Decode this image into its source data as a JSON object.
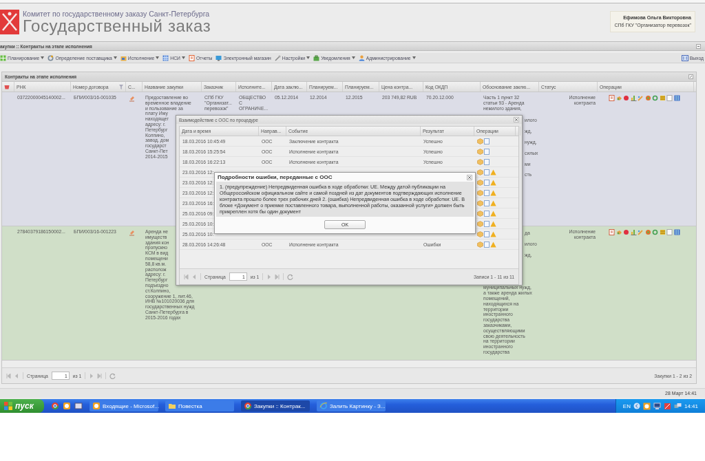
{
  "header": {
    "org": "Комитет по государственному заказу Санкт-Петербурга",
    "title": "Государственный заказ",
    "user_name": "Ефимова Ольга Викторовна",
    "user_org": "СПб ГКУ \"Организатор перевозок\""
  },
  "breadcrumb": "акупки :: Контракты на этапе исполнения",
  "menu": [
    {
      "label": "Планирование",
      "dropdown": true
    },
    {
      "label": "Определение поставщика",
      "dropdown": true
    },
    {
      "label": "Исполнение",
      "dropdown": true
    },
    {
      "label": "НСИ",
      "dropdown": true
    },
    {
      "label": "Отчеты",
      "dropdown": false
    },
    {
      "label": "Электронный магазин",
      "dropdown": false
    },
    {
      "label": "Настройки",
      "dropdown": true
    },
    {
      "label": "Уведомления",
      "dropdown": true
    },
    {
      "label": "Администрирование",
      "dropdown": true
    }
  ],
  "exit": "Выход",
  "grid": {
    "title": "Контракты на этапе исполнения",
    "columns": [
      "РНК",
      "Номер договора",
      "С...",
      "Название закупки",
      "Заказчик",
      "Исполните...",
      "Дата заклю...",
      "Планируем...",
      "Планируем...",
      "Цена контра...",
      "Код ОКДП",
      "Обоснование заклю...",
      "Статус",
      "Операции"
    ],
    "rows": [
      {
        "color": "#dcdde7",
        "rnk": "03722000045140002...",
        "number": "БПИ/003/16-001035",
        "name": [
          "Предоставление во",
          "временное владение",
          "и пользование за",
          "плату Иму",
          "находящег",
          "адресу: г.",
          "Петербург",
          "Колпино,",
          "завод, дом",
          "государст",
          "Санкт-Пет",
          "2014-2015"
        ],
        "customer": [
          "СПб ГКУ",
          "\"Организат...",
          "перевозок\""
        ],
        "contractor": [
          "ОБЩЕСТВО",
          "С",
          "ОГРАНИЧЕ..."
        ],
        "date": "05.12.2014",
        "plan_start": "12.2014",
        "plan_end": "12.2015",
        "price": "203 749,82 RUB",
        "okdp": "70.20.12.000",
        "basis_lines": [
          "Часть 1 пункт 32",
          "статьи 93 - Аренда",
          "нежилого здания,"
        ],
        "basis_tails": [
          "илого",
          "жд,",
          "нужд,",
          "силых",
          "ми",
          "сть"
        ],
        "status": [
          "Исполнение",
          "контракта"
        ]
      },
      {
        "color": "#d0dfc8",
        "rnk": "27840379186150002...",
        "number": "БПИ/003/16-001223",
        "name": [
          "Аренда не",
          "имуществ",
          "здания кон",
          "пропускно",
          "КСМ в вид",
          "помещени",
          "58,8 кв.м.",
          "располож",
          "адресу: г.",
          "Петербург",
          "подъездно",
          "ст.Колпино,",
          "сооружение 1, лит.46,",
          "ИНВ №101020036 для",
          "государственных нужд",
          "Санкт-Петербурга в",
          "2015-2016 годах"
        ],
        "basis_tails": [
          "да",
          "илого",
          "жд,"
        ],
        "basis_lines": [
          "муниципальных нужд,",
          "а также аренда жилых",
          "помещений,",
          "находящихся на",
          "территории",
          "иностранного",
          "государства",
          "заказчиками,",
          "осуществляющими",
          "свою деятельность",
          "на территории",
          "иностранного",
          "государства"
        ],
        "status": [
          "Исполнение",
          "контракта"
        ]
      }
    ],
    "pager": {
      "label": "Страница",
      "page": "1",
      "of": "из 1",
      "summary": "Закупки 1 - 2 из 2"
    }
  },
  "interaction_dialog": {
    "title": "Взаимодействие с ООС по процедуре",
    "columns": [
      "Дата и время",
      "Направ...",
      "Событие",
      "Результат",
      "Операции"
    ],
    "rows": [
      {
        "date": "18.03.2016 10:45:49",
        "direction": "ООС",
        "event": "Заключение контракта",
        "result": "Успешно",
        "warning": false
      },
      {
        "date": "18.03.2016 15:25:54",
        "direction": "ООС",
        "event": "Исполнение контракта",
        "result": "Успешно",
        "warning": false
      },
      {
        "date": "18.03.2016 16:22:13",
        "direction": "ООС",
        "event": "Исполнение контракта",
        "result": "Успешно",
        "warning": false
      },
      {
        "date": "23.03.2016 12:",
        "warning": true
      },
      {
        "date": "23.03.2016 12:",
        "warning": true
      },
      {
        "date": "23.03.2016 12:",
        "warning": true
      },
      {
        "date": "23.03.2016 16:",
        "warning": true
      },
      {
        "date": "25.03.2016 09:",
        "warning": true
      },
      {
        "date": "25.03.2016 10:",
        "warning": true
      },
      {
        "date": "25.03.2016 10:",
        "warning": true
      },
      {
        "date": "28.03.2016 14:26:48",
        "direction": "ООС",
        "event": "Исполнение контракта",
        "result": "Ошибки",
        "warning": true
      }
    ],
    "pager": {
      "label": "Страница",
      "page": "1",
      "of": "из 1",
      "summary": "Записи 1 - 11 из 11"
    }
  },
  "error_dialog": {
    "title": "Подробности ошибки, переданные с ООС",
    "message": "1. (предупреждение) Непредвиденная ошибка в ходе обработки: UE. Между датой публикации на Общероссийском официальном сайте и самой поздней из дат документов подтверждающих исполнение контракта прошло более трех рабочих дней 2. (ошибка) Непредвиденная ошибка в ходе обработки: UE. В блоке «Документ о приемке поставленного товара, выполненной работы, оказанной услуги» должен быть прикреплен хотя бы один документ",
    "button": "OK"
  },
  "status_bar": {
    "time": "28 Март 14:41"
  },
  "taskbar": {
    "start": "пуск",
    "tasks": [
      {
        "label": "Входящие - Microsof...",
        "selected": false
      },
      {
        "label": "Повестка",
        "selected": false
      },
      {
        "label": "Закупки :: Контрак...",
        "selected": true
      },
      {
        "label": "Залить Картинку - З...",
        "selected": false
      }
    ],
    "lang": "EN",
    "clock": "14:41"
  }
}
